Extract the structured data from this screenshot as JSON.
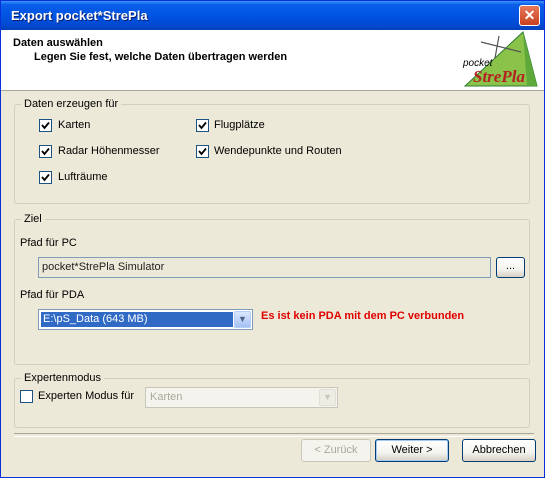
{
  "window": {
    "title": "Export pocket*StrePla"
  },
  "header": {
    "title": "Daten auswählen",
    "subtitle": "Legen Sie fest, welche Daten übertragen werden",
    "logo_top": "pocket",
    "logo_main": "StrePla"
  },
  "daten_group": {
    "legend": "Daten erzeugen für",
    "items": [
      {
        "label": "Karten",
        "checked": true
      },
      {
        "label": "Radar Höhenmesser",
        "checked": true
      },
      {
        "label": "Lufträume",
        "checked": true
      },
      {
        "label": "Flugplätze",
        "checked": true
      },
      {
        "label": "Wendepunkte und Routen",
        "checked": true
      }
    ]
  },
  "ziel_group": {
    "legend": "Ziel",
    "pc_label": "Pfad für PC",
    "pc_value": "pocket*StrePla Simulator",
    "browse_label": "...",
    "pda_label": "Pfad für PDA",
    "pda_value": "E:\\pS_Data (643 MB)",
    "warning": "Es ist kein PDA mit dem PC verbunden",
    "warning_color": "#e00000"
  },
  "experten_group": {
    "legend": "Expertenmodus",
    "checkbox_label": "Experten Modus für",
    "checked": false,
    "select_value": "Karten"
  },
  "buttons": {
    "back": "< Zurück",
    "next": "Weiter >",
    "cancel": "Abbrechen"
  },
  "colors": {
    "titlebar": "#0054e3",
    "dialog_bg": "#ece9d8",
    "check": "#21a121"
  }
}
